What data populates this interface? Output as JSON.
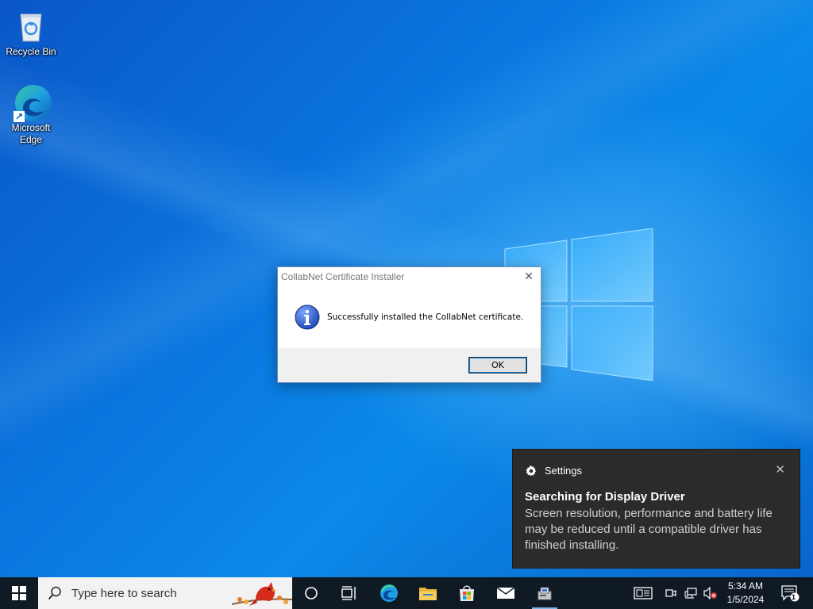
{
  "desktop": {
    "icons": [
      {
        "label": "Recycle Bin",
        "icon": "recycle-bin-icon"
      },
      {
        "label": "Microsoft Edge",
        "icon": "edge-icon"
      }
    ]
  },
  "dialog": {
    "title": "CollabNet Certificate Installer",
    "message": "Successfully installed the CollabNet certificate.",
    "ok_label": "OK",
    "close_glyph": "✕"
  },
  "toast": {
    "app_name": "Settings",
    "heading": "Searching for Display Driver",
    "body": "Screen resolution, performance and battery life may be reduced until a compatible driver has finished installing.",
    "close_glyph": "✕"
  },
  "taskbar": {
    "search_placeholder": "Type here to search",
    "time": "5:34 AM",
    "date": "1/5/2024",
    "notification_count": "1",
    "pinned": [
      "task-view-icon",
      "edge-icon",
      "file-explorer-icon",
      "store-icon",
      "mail-icon",
      "installer-app-icon"
    ]
  },
  "colors": {
    "accent": "#0078d7",
    "taskbar_bg": "#0f1a24",
    "toast_bg": "#2b2b2b"
  }
}
